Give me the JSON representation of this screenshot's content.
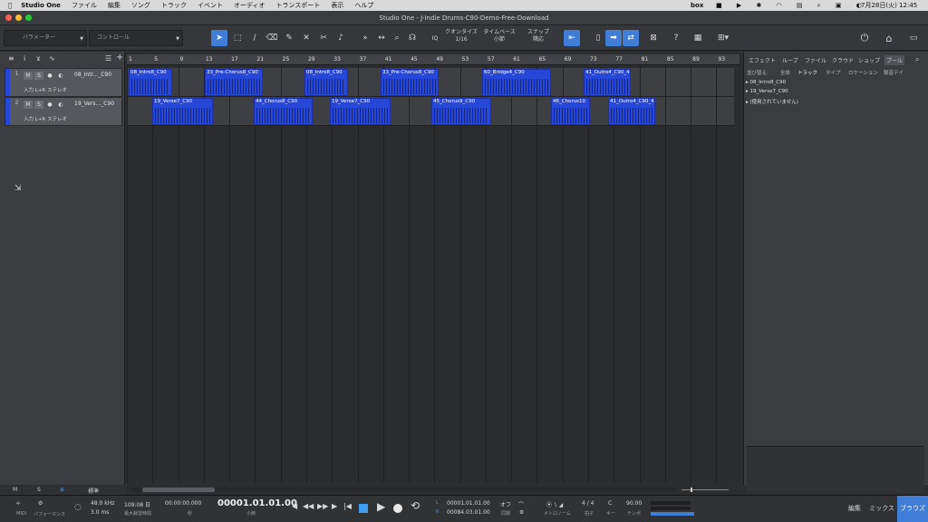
{
  "menubar": {
    "app": "Studio One",
    "items": [
      "ファイル",
      "編集",
      "ソング",
      "トラック",
      "イベント",
      "オーディオ",
      "トランスポート",
      "表示",
      "ヘルプ"
    ],
    "box": "box",
    "datetime": "7月28日(火) 12:45"
  },
  "window": {
    "title": "Studio One - J-Indie Drums-C90-Demo-Free-Download"
  },
  "toolbar": {
    "param_label": "パラメーター",
    "control_label": "コントロール",
    "quantize_label": "クオンタイズ",
    "quantize_value": "1/16",
    "timebase_label": "タイムベース",
    "timebase_value": "小節",
    "snap_label": "スナップ",
    "snap_value": "隣応"
  },
  "tracks": [
    {
      "number": "1",
      "name": "08_Intr..._C90",
      "input": "入力 L+R ステレオ"
    },
    {
      "number": "2",
      "name": "19_Vers..._C90",
      "input": "入力 L+R ステレオ"
    }
  ],
  "ruler": [
    "1",
    "5",
    "9",
    "13",
    "17",
    "21",
    "25",
    "29",
    "33",
    "37",
    "41",
    "45",
    "49",
    "53",
    "57",
    "61",
    "65",
    "69",
    "73",
    "77",
    "81",
    "85",
    "89",
    "93"
  ],
  "clips_track1": [
    "08_Intro8_C90",
    "33_Pre-Chorus8_C90",
    "08_Intro8_C90",
    "33_Pre-Chorus8_C90",
    "60_Bridge4_C90",
    "41_Outro4_C90_4l"
  ],
  "clips_track2": [
    "19_Verse7_C90",
    "44_Chorus8_C90",
    "19_Verse7_C90",
    "45_Chorus9_C90",
    "46_Chorus10",
    "41_Outro4_C90_4l"
  ],
  "leftfooter": {
    "m": "M",
    "s": "S",
    "mode": "標準"
  },
  "rightpanel": {
    "tabs": [
      "エフェクト",
      "ループ",
      "ファイル",
      "クラウド",
      "ショップ",
      "プール"
    ],
    "sub": [
      "並び替え:",
      "全体",
      "トラック",
      "タイプ",
      "ロケーション",
      "録音テイ"
    ],
    "items": [
      "08_Intro8_C90",
      "19_Verse7_C90",
      "(使用されていません)"
    ]
  },
  "transport": {
    "midi": "MIDI",
    "performance": "パフォーマンス",
    "samplerate": "48.0 kHz",
    "latency": "3.0 ms",
    "duration": "109:08 日",
    "duration_sub": "最大録音時間",
    "time": "00:00:00.000",
    "time_sub": "秒",
    "position": "00001.01.01.00",
    "position_sub": "小節",
    "loop_l": "00001.01.01.00",
    "loop_r": "00084.03.01.00",
    "sync": "オフ",
    "sync_sub": "同期",
    "metronome": "メトロノーム",
    "signature": "4 / 4",
    "signature_sub": "拍子",
    "key": "C",
    "key_sub": "キー",
    "tempo": "90.00",
    "tempo_sub": "テンポ"
  },
  "bottomtabs": [
    "編集",
    "ミックス",
    "ブラウズ"
  ],
  "colors": {
    "clip": "#2647d8",
    "accent": "#3f7dd6"
  }
}
